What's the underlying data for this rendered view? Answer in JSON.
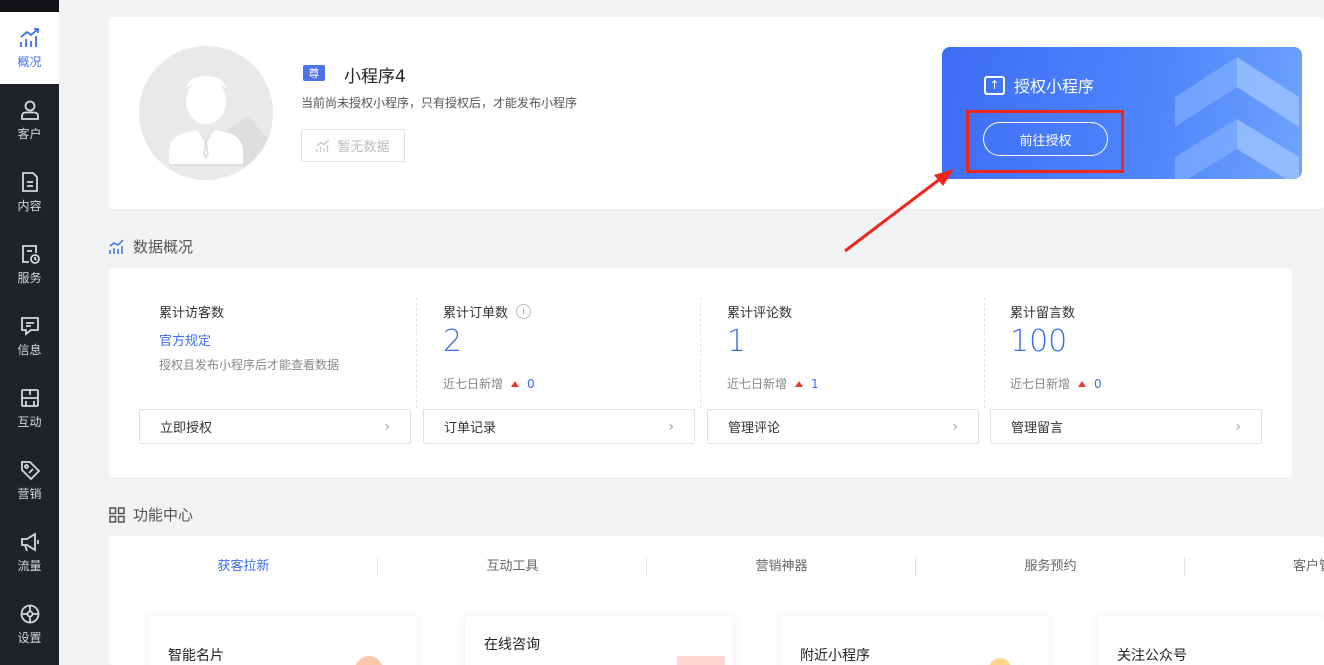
{
  "sidebar": {
    "items": [
      {
        "label": "概况",
        "icon": "chart-icon",
        "active": true
      },
      {
        "label": "客户",
        "icon": "user-icon"
      },
      {
        "label": "内容",
        "icon": "document-icon"
      },
      {
        "label": "服务",
        "icon": "service-icon"
      },
      {
        "label": "信息",
        "icon": "message-icon"
      },
      {
        "label": "互动",
        "icon": "interact-icon"
      },
      {
        "label": "营销",
        "icon": "tag-icon"
      },
      {
        "label": "流量",
        "icon": "megaphone-icon"
      },
      {
        "label": "设置",
        "icon": "gear-icon"
      }
    ]
  },
  "profile": {
    "badge": "尊",
    "app_name": "小程序4",
    "description": "当前尚未授权小程序，只有授权后，才能发布小程序",
    "no_data_label": "暂无数据"
  },
  "auth": {
    "title": "授权小程序",
    "button": "前往授权"
  },
  "data_overview": {
    "title": "数据概况",
    "stats": [
      {
        "label": "累计访客数",
        "link": "官方规定",
        "note": "授权且发布小程序后才能查看数据",
        "button": "立即授权"
      },
      {
        "label": "累计订单数",
        "info": "i",
        "value": "2",
        "sub_label": "近七日新增",
        "sub_value": "0",
        "button": "订单记录"
      },
      {
        "label": "累计评论数",
        "value": "1",
        "sub_label": "近七日新增",
        "sub_value": "1",
        "button": "管理评论"
      },
      {
        "label": "累计留言数",
        "value": "100",
        "sub_label": "近七日新增",
        "sub_value": "0",
        "button": "管理留言"
      }
    ]
  },
  "function_center": {
    "title": "功能中心",
    "tabs": [
      "获客拉新",
      "互动工具",
      "营销神器",
      "服务预约",
      "客户管"
    ],
    "features": [
      "智能名片",
      "在线咨询",
      "附近小程序",
      "关注公众号"
    ]
  },
  "colors": {
    "accent": "#3b6df0",
    "sidebar_bg": "#1f2226",
    "annotation_red": "#f0261b"
  }
}
